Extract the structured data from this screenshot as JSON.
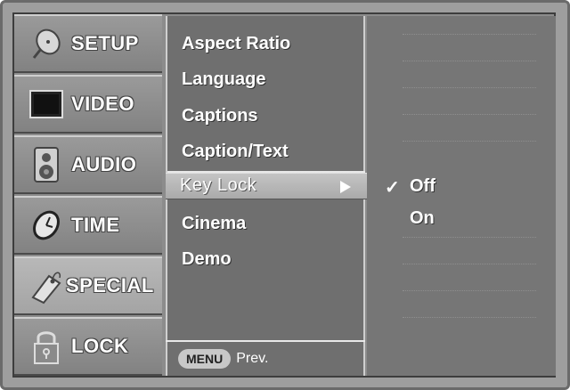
{
  "categories": [
    {
      "label": "SETUP",
      "icon": "satellite-dish-icon"
    },
    {
      "label": "VIDEO",
      "icon": "tv-screen-icon"
    },
    {
      "label": "AUDIO",
      "icon": "speaker-icon"
    },
    {
      "label": "TIME",
      "icon": "clock-icon"
    },
    {
      "label": "SPECIAL",
      "icon": "tag-icon",
      "active": true
    },
    {
      "label": "LOCK",
      "icon": "padlock-icon"
    }
  ],
  "submenu": {
    "items": [
      "Aspect Ratio",
      "Language",
      "Captions",
      "Caption/Text"
    ],
    "selected": "Key Lock",
    "items_after": [
      "Cinema",
      "Demo"
    ]
  },
  "options": {
    "checked": "Off",
    "other": "On"
  },
  "footer": {
    "menu_button": "MENU",
    "prev_label": "Prev."
  }
}
